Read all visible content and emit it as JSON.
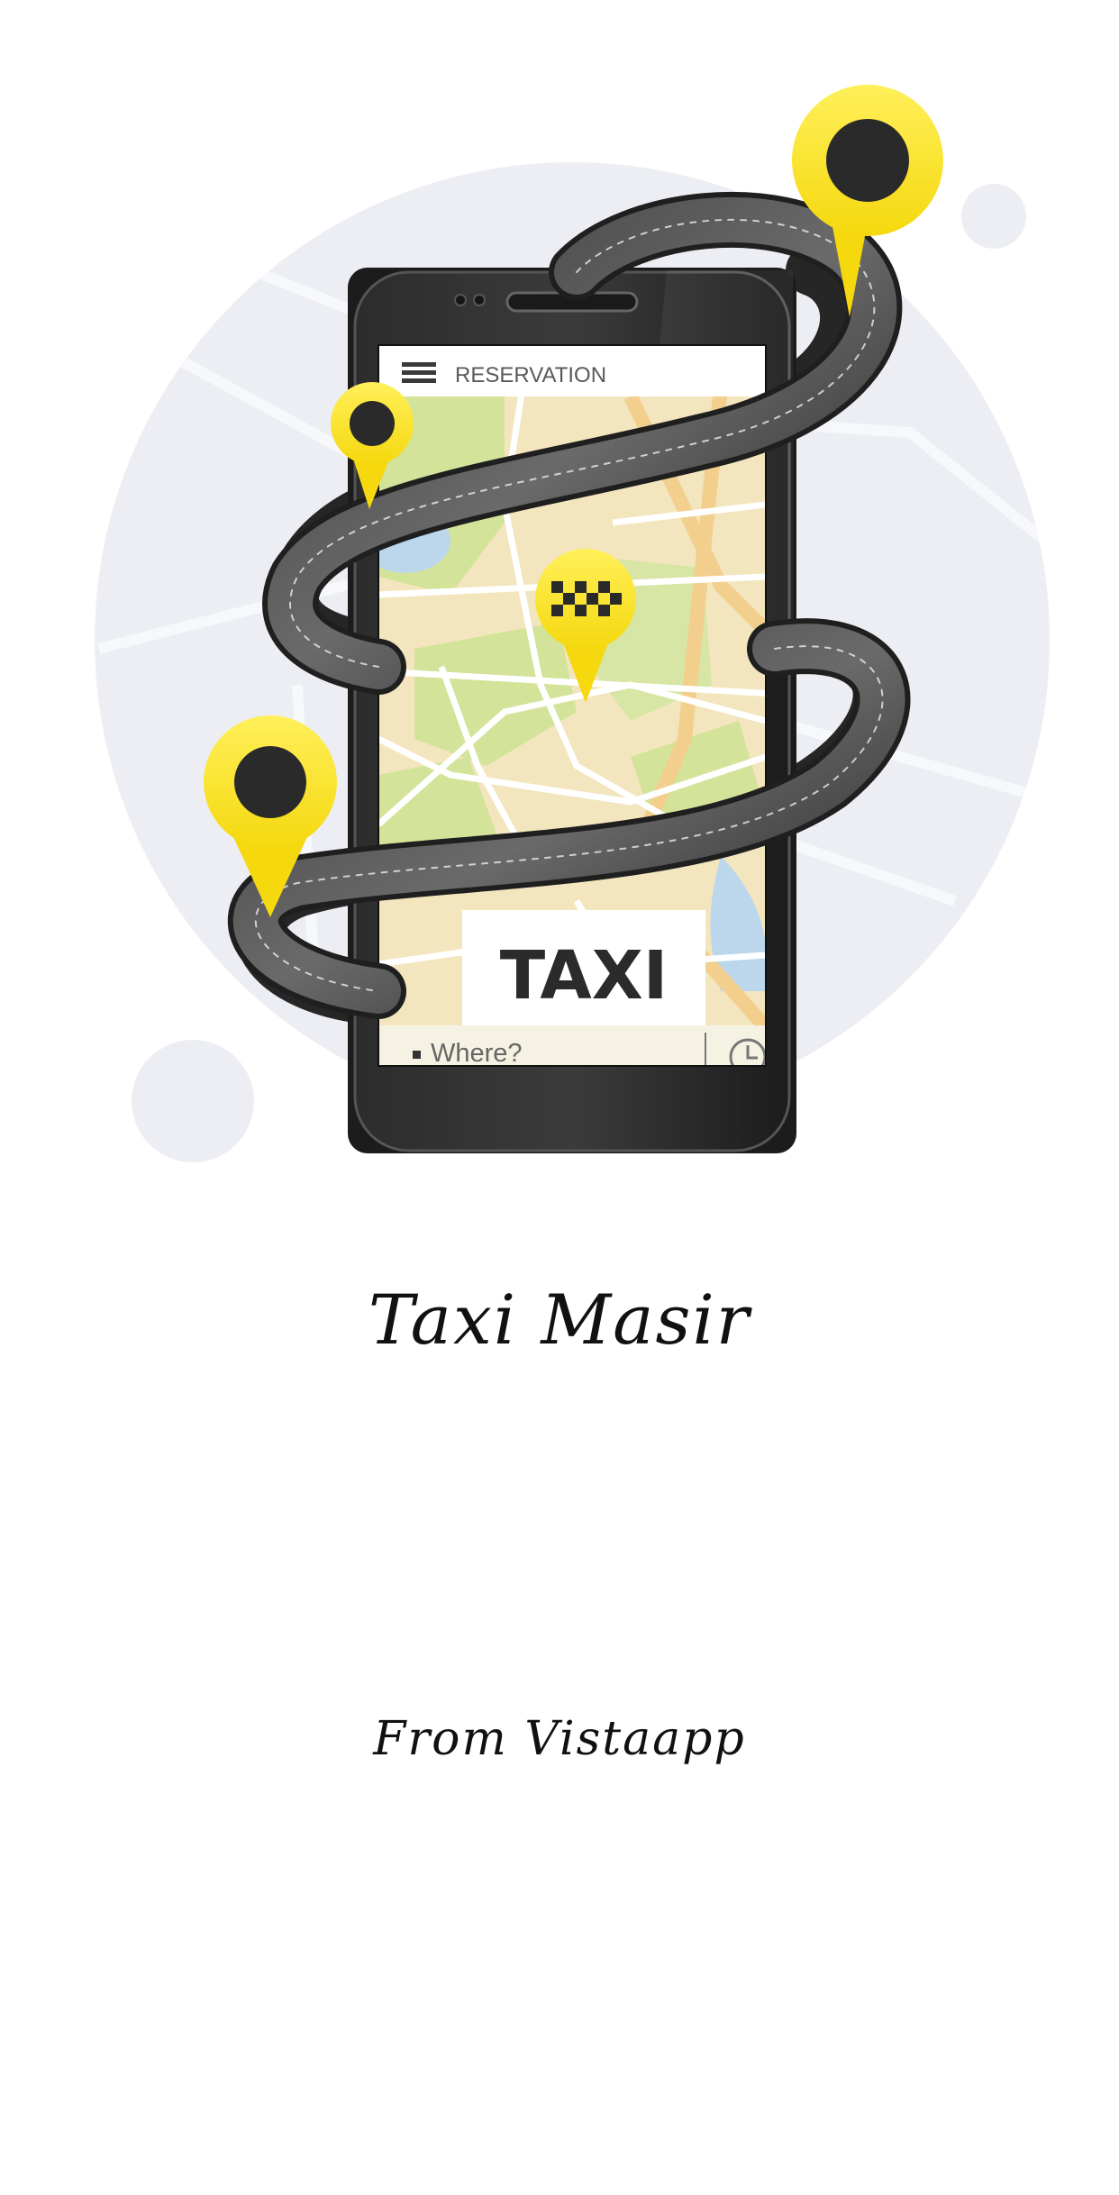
{
  "phone_screen": {
    "header_title": "RESERVATION",
    "logo_text": "TAXI",
    "search_placeholder": "Where?"
  },
  "icons": [
    "hamburger-menu-icon",
    "clock-icon",
    "map-pin-icon",
    "taxi-pin-icon"
  ],
  "colors": {
    "accent_yellow": "#FFE234",
    "road_dark": "#2a2a2a",
    "bg_circle": "#EDEEF3"
  },
  "app_title": "Taxi Masir",
  "credit": "From Vistaapp"
}
